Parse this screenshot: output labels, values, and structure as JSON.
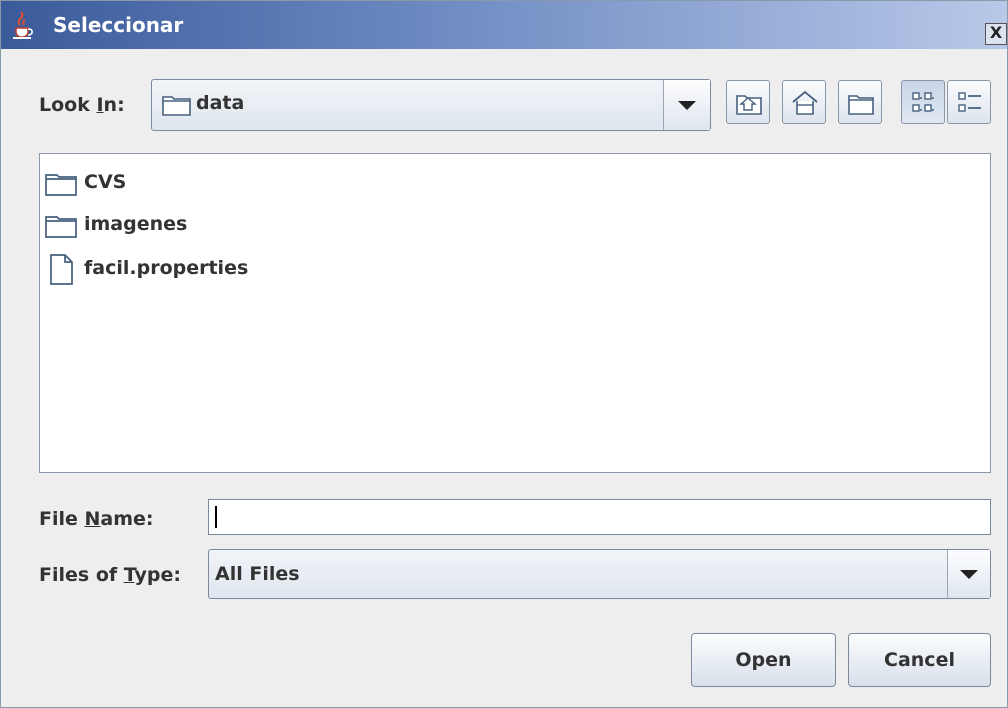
{
  "window": {
    "title": "Seleccionar",
    "close_glyph": "X"
  },
  "lookin": {
    "label_prefix": "Look ",
    "label_mnemonic": "I",
    "label_suffix": "n:",
    "value": "data",
    "icon": "folder-icon"
  },
  "toolbar": {
    "buttons": [
      {
        "name": "up-one-level",
        "icon": "folder-up-icon"
      },
      {
        "name": "home",
        "icon": "home-icon"
      },
      {
        "name": "new-folder",
        "icon": "new-folder-icon"
      },
      {
        "name": "list-view",
        "icon": "list-view-icon",
        "pressed": true
      },
      {
        "name": "details-view",
        "icon": "details-view-icon"
      }
    ]
  },
  "files": [
    {
      "name": "CVS",
      "type": "folder"
    },
    {
      "name": "imagenes",
      "type": "folder"
    },
    {
      "name": "facil.properties",
      "type": "file"
    }
  ],
  "filename": {
    "label_prefix": "File ",
    "label_mnemonic": "N",
    "label_suffix": "ame:",
    "value": ""
  },
  "filetype": {
    "label_prefix": "Files of ",
    "label_mnemonic": "T",
    "label_suffix": "ype:",
    "value": "All Files"
  },
  "buttons": {
    "open": "Open",
    "cancel": "Cancel"
  }
}
